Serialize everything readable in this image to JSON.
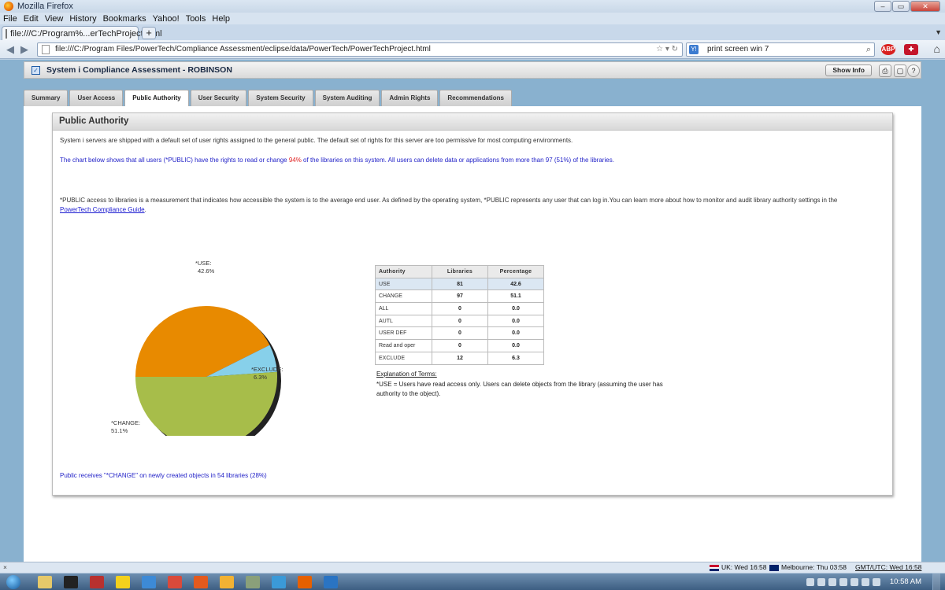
{
  "window": {
    "title": "Mozilla Firefox",
    "controls": {
      "minimize": "–",
      "maximize": "▭",
      "close": "✕"
    }
  },
  "menu": [
    "File",
    "Edit",
    "View",
    "History",
    "Bookmarks",
    "Yahoo!",
    "Tools",
    "Help"
  ],
  "browser_tab": {
    "label": "file:///C:/Program%...erTechProject.html",
    "new_tab": "+"
  },
  "address": {
    "url": "file:///C:/Program Files/PowerTech/Compliance Assessment/eclipse/data/PowerTech/PowerTechProject.html",
    "search_engine": "Y!",
    "search_value": "print screen win 7"
  },
  "app": {
    "title": "System i Compliance Assessment - ROBINSON",
    "show_info_label": "Show Info",
    "tabs": [
      "Summary",
      "User Access",
      "Public Authority",
      "User Security",
      "System Security",
      "System Auditing",
      "Admin Rights",
      "Recommendations"
    ],
    "active_tab_index": 2
  },
  "panel": {
    "title": "Public Authority",
    "intro": "System i servers are shipped with a default set of user rights assigned to the general public. The default set of rights for this server are too permissive for most computing environments.",
    "chart_note_before": "The chart below shows that all users (*PUBLIC) have the rights to read or change ",
    "chart_note_pct": "94%",
    "chart_note_after": " of the libraries on this system. All users can delete data or applications from more than 97 (51%) of the libraries.",
    "access_text": "*PUBLIC access to libraries is a measurement that indicates how accessible the system is to the average end user. As defined by the operating system, *PUBLIC represents any user that can log in.You can learn more about how to monitor and audit library authority settings in the ",
    "guide_link": "PowerTech Compliance Guide",
    "access_text_end": ".",
    "terms_heading": "Explanation of Terms:",
    "terms_text": "*USE = Users have read access only. Users can delete objects from the library (assuming the user has authority to the object).",
    "public_receives": "Public receives \"*CHANGE\" on newly created objects in 54 libraries (28%)"
  },
  "table": {
    "headers": [
      "Authority",
      "Libraries",
      "Percentage"
    ],
    "rows": [
      {
        "authority": "USE",
        "libraries": "81",
        "percentage": "42.6"
      },
      {
        "authority": "CHANGE",
        "libraries": "97",
        "percentage": "51.1"
      },
      {
        "authority": "ALL",
        "libraries": "0",
        "percentage": "0.0"
      },
      {
        "authority": "AUTL",
        "libraries": "0",
        "percentage": "0.0"
      },
      {
        "authority": "USER DEF",
        "libraries": "0",
        "percentage": "0.0"
      },
      {
        "authority": "Read and oper",
        "libraries": "0",
        "percentage": "0.0"
      },
      {
        "authority": "EXCLUDE",
        "libraries": "12",
        "percentage": "6.3"
      }
    ]
  },
  "chart_data": {
    "type": "pie",
    "slices": [
      {
        "name": "*USE:",
        "label": "42.6%",
        "value": 42.6,
        "color": "#e88a00"
      },
      {
        "name": "*EXCLUDE:",
        "label": "6.3%",
        "value": 6.3,
        "color": "#87d0ea"
      },
      {
        "name": "*CHANGE:",
        "label": "51.1%",
        "value": 51.1,
        "color": "#a7bd4a"
      }
    ]
  },
  "status": {
    "close": "×",
    "clocks": [
      "UK: Wed 16:58",
      "Melbourne: Thu 03:58",
      "GMT/UTC: Wed 16:58"
    ]
  },
  "taskbar": {
    "time": "10:58 AM"
  },
  "colors": {
    "accent": "#2323c8",
    "warning": "#e02020"
  }
}
